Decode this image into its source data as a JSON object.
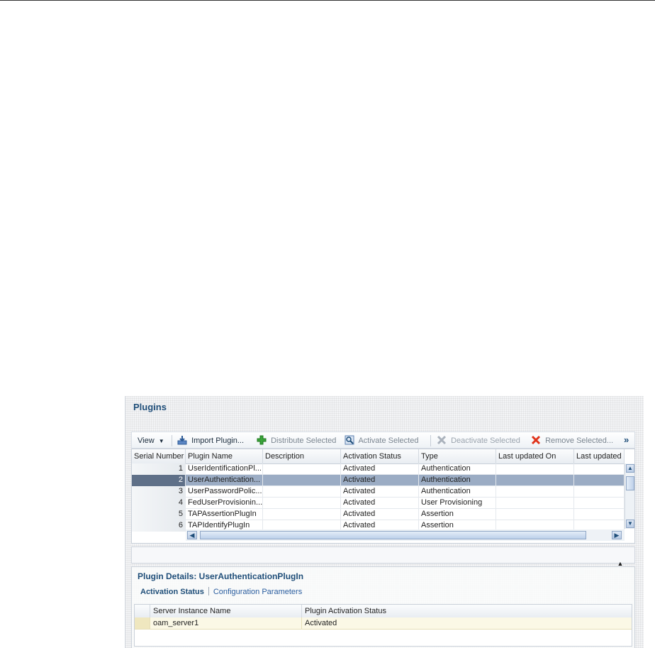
{
  "panel": {
    "title": "Plugins"
  },
  "toolbar": {
    "view_label": "View",
    "import_label": "Import Plugin...",
    "distribute_label": "Distribute Selected",
    "activate_label": "Activate Selected",
    "deactivate_label": "Deactivate Selected",
    "remove_label": "Remove Selected...",
    "more_label": "»"
  },
  "table": {
    "columns": [
      "Serial Number",
      "Plugin Name",
      "Description",
      "Activation Status",
      "Type",
      "Last updated On",
      "Last updated"
    ],
    "rows": [
      {
        "serial": "1",
        "name": "UserIdentificationPl...",
        "description": "",
        "status": "Activated",
        "type": "Authentication",
        "updated_on": "",
        "updated": ""
      },
      {
        "serial": "2",
        "name": "UserAuthentication...",
        "description": "",
        "status": "Activated",
        "type": "Authentication",
        "updated_on": "",
        "updated": "",
        "selected": true
      },
      {
        "serial": "3",
        "name": "UserPasswordPolic...",
        "description": "",
        "status": "Activated",
        "type": "Authentication",
        "updated_on": "",
        "updated": ""
      },
      {
        "serial": "4",
        "name": "FedUserProvisionin...",
        "description": "",
        "status": "Activated",
        "type": "User Provisioning",
        "updated_on": "",
        "updated": ""
      },
      {
        "serial": "5",
        "name": "TAPAssertionPlugIn",
        "description": "",
        "status": "Activated",
        "type": "Assertion",
        "updated_on": "",
        "updated": ""
      },
      {
        "serial": "6",
        "name": "TAPIdentifyPlugIn",
        "description": "",
        "status": "Activated",
        "type": "Assertion",
        "updated_on": "",
        "updated": ""
      }
    ]
  },
  "details": {
    "title": "Plugin Details: UserAuthenticationPlugIn",
    "tabs": [
      "Activation Status",
      "Configuration Parameters"
    ],
    "columns": [
      "Server Instance Name",
      "Plugin Activation Status"
    ],
    "rows": [
      {
        "server": "oam_server1",
        "status": "Activated"
      }
    ]
  },
  "colors": {
    "title_blue": "#1f4e79",
    "selected_row": "#9bacc4",
    "selected_rownum": "#5f7088",
    "remove_icon": "#e0341c",
    "add_icon": "#3aa33a"
  },
  "icons": [
    "view-dropdown-icon",
    "import-icon",
    "distribute-plus-icon",
    "activate-magnifier-icon",
    "deactivate-x-icon",
    "remove-x-icon",
    "more-chevron-icon"
  ]
}
